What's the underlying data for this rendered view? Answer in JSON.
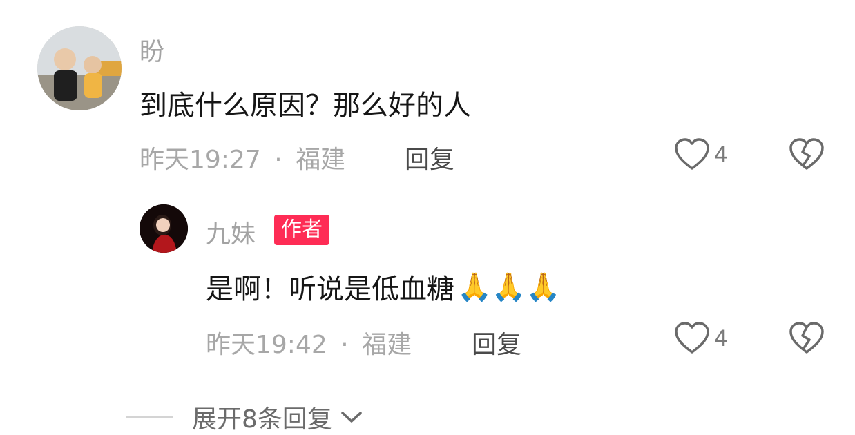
{
  "comment": {
    "username": "盼",
    "text": "到底什么原因？那么好的人",
    "time": "昨天19:27",
    "separator": "·",
    "location": "福建",
    "reply_label": "回复",
    "like_count": "4",
    "avatar_icon": "user-photo-avatar-icon"
  },
  "reply": {
    "username": "九妹",
    "badge": "作者",
    "text": "是啊！听说是低血糖",
    "emojis": [
      "🙏",
      "🙏",
      "🙏"
    ],
    "time": "昨天19:42",
    "separator": "·",
    "location": "福建",
    "reply_label": "回复",
    "like_count": "4",
    "avatar_icon": "user-photo-avatar-icon"
  },
  "expand": {
    "label": "展开8条回复"
  },
  "colors": {
    "badge_bg": "#fe2c55",
    "secondary_text": "#a7a7a7",
    "primary_text": "#161616"
  }
}
